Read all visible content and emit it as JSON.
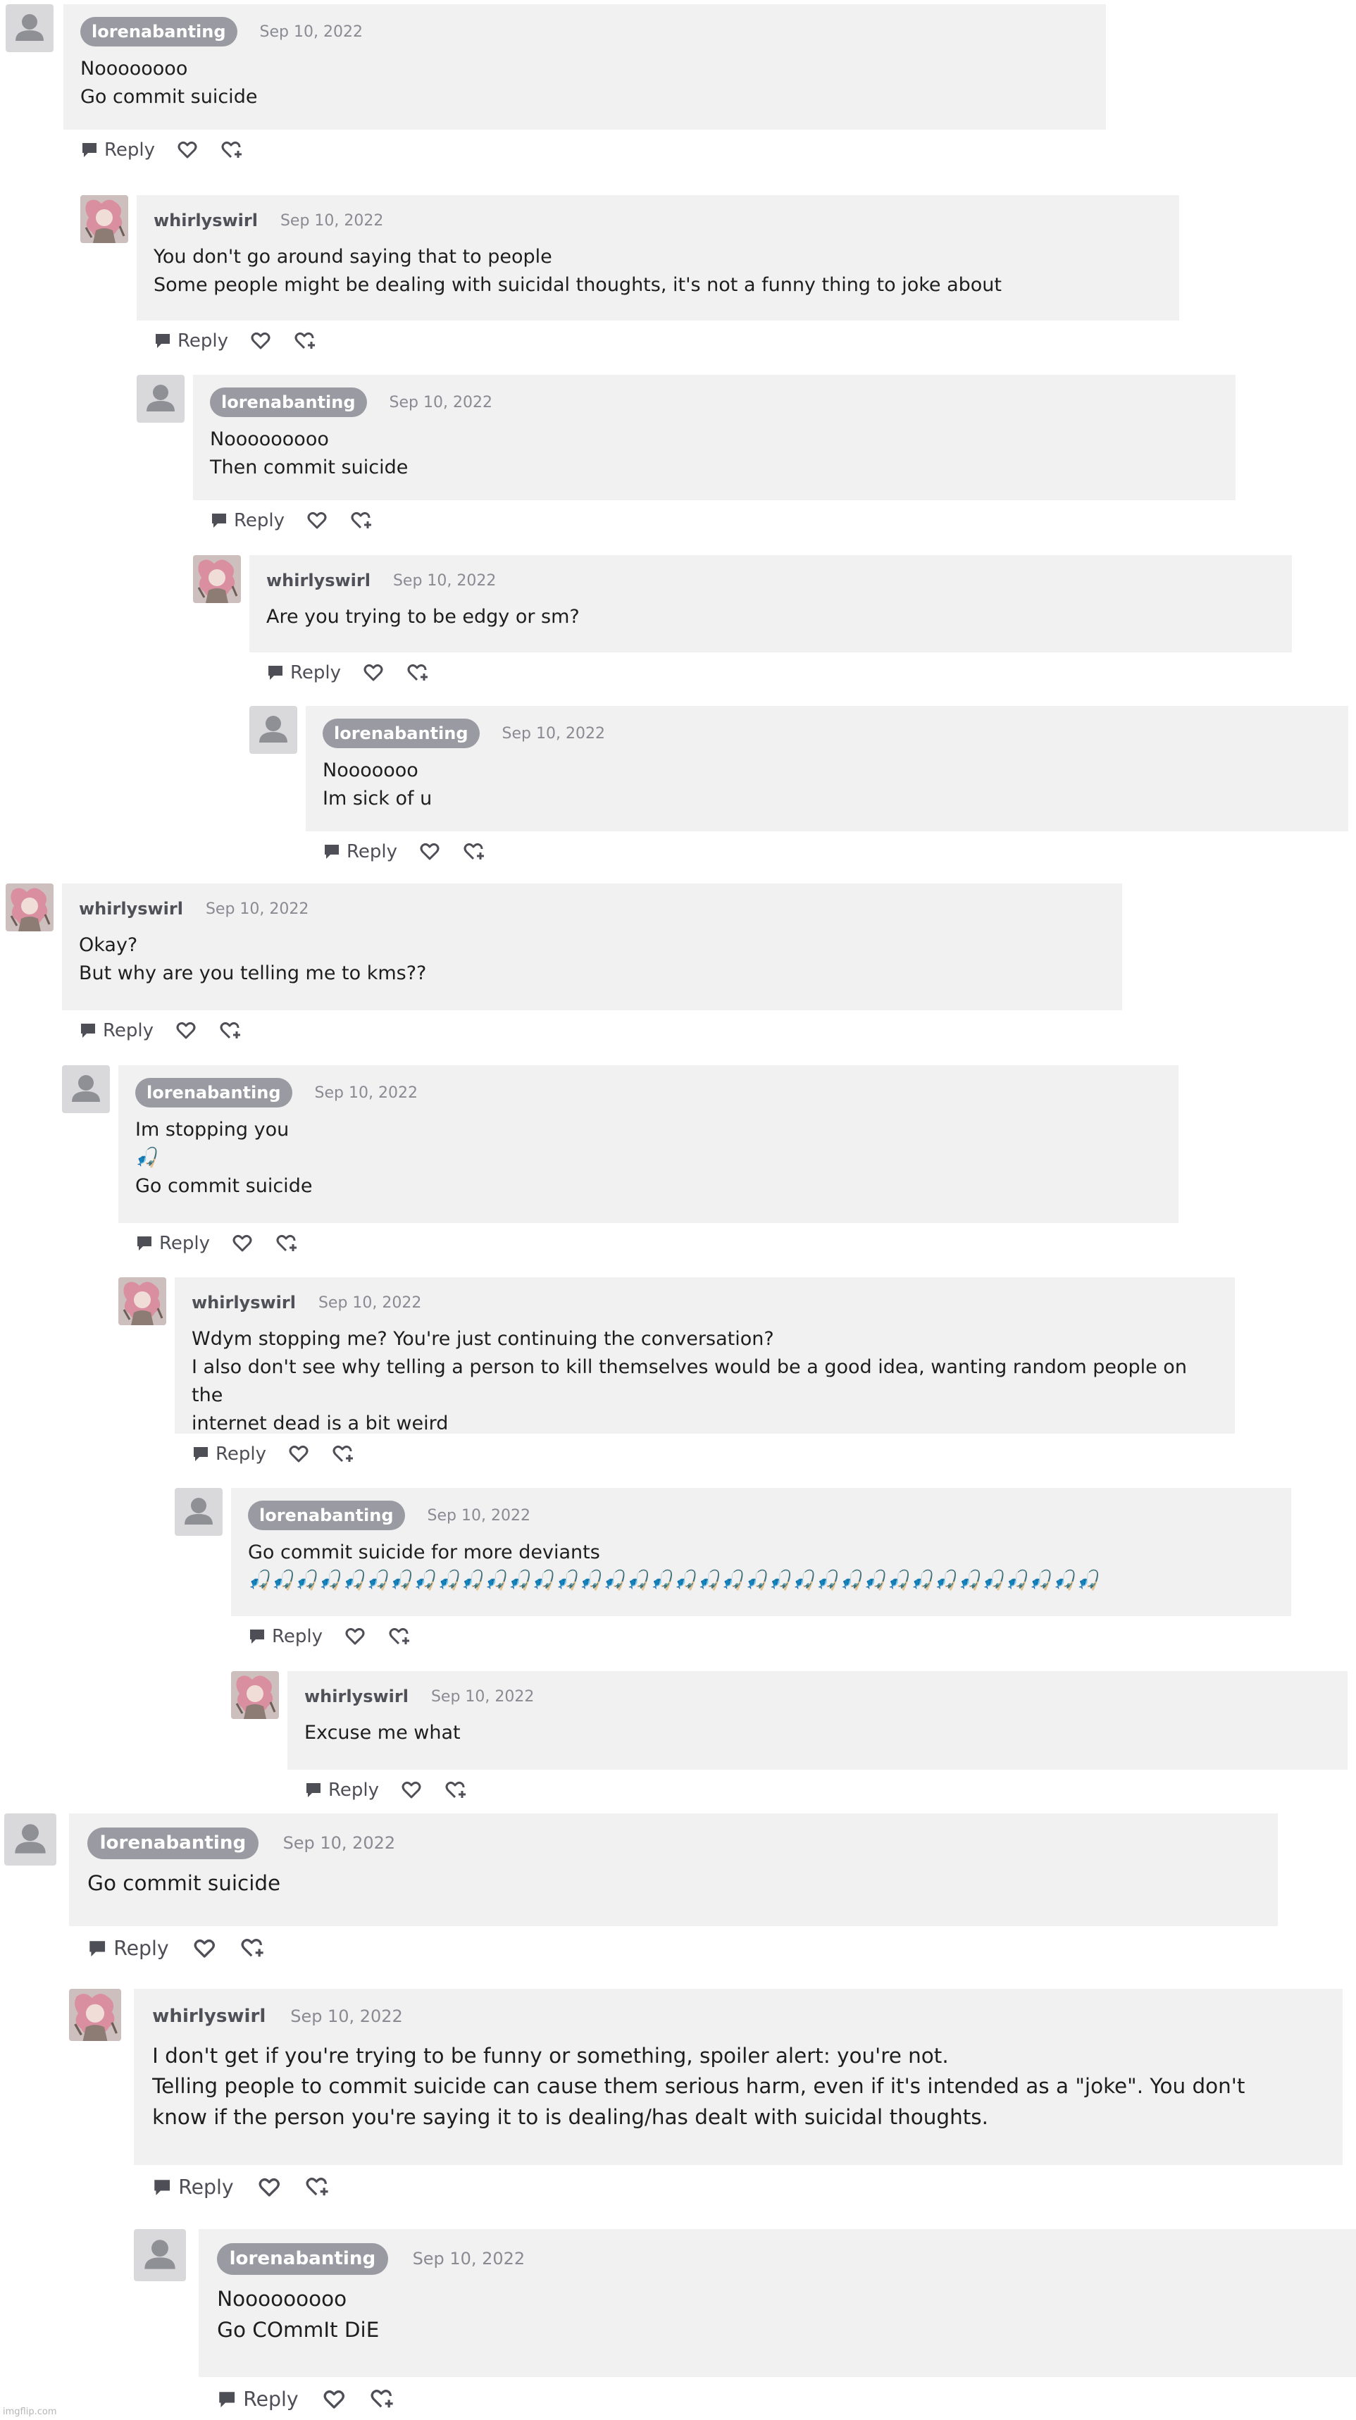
{
  "comments": [
    {
      "user": "lorenabanting",
      "date": "Sep 10, 2022",
      "lines": [
        "Noooooooo",
        "Go commit suicide"
      ],
      "reply": "Reply"
    },
    {
      "user": "whirlyswirl",
      "date": "Sep 10, 2022",
      "lines": [
        "You don't go around saying that to people",
        "Some people might be dealing with suicidal thoughts, it's not a funny thing to joke about"
      ],
      "reply": "Reply"
    },
    {
      "user": "lorenabanting",
      "date": "Sep 10, 2022",
      "lines": [
        "Nooooooooo",
        "Then commit suicide"
      ],
      "reply": "Reply"
    },
    {
      "user": "whirlyswirl",
      "date": "Sep 10, 2022",
      "lines": [
        "Are you trying to be edgy or sm?"
      ],
      "reply": "Reply"
    },
    {
      "user": "lorenabanting",
      "date": "Sep 10, 2022",
      "lines": [
        "Nooooooo",
        "Im sick of u"
      ],
      "reply": "Reply"
    },
    {
      "user": "whirlyswirl",
      "date": "Sep 10, 2022",
      "lines": [
        "Okay?",
        "But why are you telling me to kms??"
      ],
      "reply": "Reply"
    },
    {
      "user": "lorenabanting",
      "date": "Sep 10, 2022",
      "lines": [
        "Im stopping you",
        "🎣",
        "Go commit suicide"
      ],
      "reply": "Reply"
    },
    {
      "user": "whirlyswirl",
      "date": "Sep 10, 2022",
      "lines": [
        "Wdym stopping me? You're just continuing the conversation?",
        "I also don't see why telling a person to kill themselves would be a good idea, wanting random people on the",
        "internet dead is a bit weird"
      ],
      "reply": "Reply"
    },
    {
      "user": "lorenabanting",
      "date": "Sep 10, 2022",
      "lines": [
        "Go commit suicide for more deviants",
        "🎣🎣🎣🎣🎣🎣🎣🎣🎣🎣🎣🎣🎣🎣🎣🎣🎣🎣🎣🎣🎣🎣🎣🎣🎣🎣🎣🎣🎣🎣🎣🎣🎣🎣🎣🎣"
      ],
      "reply": "Reply"
    },
    {
      "user": "whirlyswirl",
      "date": "Sep 10, 2022",
      "lines": [
        "Excuse me what"
      ],
      "reply": "Reply"
    },
    {
      "user": "lorenabanting",
      "date": "Sep 10, 2022",
      "lines": [
        "Go commit suicide"
      ],
      "reply": "Reply"
    },
    {
      "user": "whirlyswirl",
      "date": "Sep 10, 2022",
      "lines": [
        "I don't get if you're trying to be funny or something, spoiler alert: you're not.",
        "Telling people to commit suicide can cause them serious harm, even if it's intended as a \"joke\". You don't",
        "know if the person you're saying it to is dealing/has dealt with suicidal thoughts."
      ],
      "reply": "Reply"
    },
    {
      "user": "lorenabanting",
      "date": "Sep 10, 2022",
      "lines": [
        "Nooooooooo",
        "Go COmmIt DiE"
      ],
      "reply": "Reply"
    }
  ],
  "watermark": "imgflip.com"
}
